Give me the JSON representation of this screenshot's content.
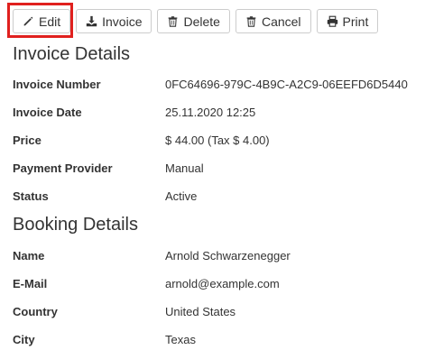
{
  "toolbar": {
    "edit_label": "Edit",
    "invoice_label": "Invoice",
    "delete_label": "Delete",
    "cancel_label": "Cancel",
    "print_label": "Print"
  },
  "invoice_details": {
    "title": "Invoice Details",
    "rows": [
      {
        "label": "Invoice Number",
        "value": "0FC64696-979C-4B9C-A2C9-06EEFD6D5440"
      },
      {
        "label": "Invoice Date",
        "value": "25.11.2020 12:25"
      },
      {
        "label": "Price",
        "value": "$ 44.00 (Tax $ 4.00)"
      },
      {
        "label": "Payment Provider",
        "value": "Manual"
      },
      {
        "label": "Status",
        "value": "Active"
      }
    ]
  },
  "booking_details": {
    "title": "Booking Details",
    "rows": [
      {
        "label": "Name",
        "value": "Arnold Schwarzenegger"
      },
      {
        "label": "E-Mail",
        "value": "arnold@example.com"
      },
      {
        "label": "Country",
        "value": "United States"
      },
      {
        "label": "City",
        "value": "Texas"
      }
    ]
  },
  "colors": {
    "highlight": "#e0201e",
    "text": "#333333",
    "button_border": "#cccccc"
  },
  "icons": {
    "edit": "pencil-icon",
    "invoice": "download-icon",
    "delete": "trash-icon",
    "cancel": "trash-icon",
    "print": "printer-icon"
  }
}
